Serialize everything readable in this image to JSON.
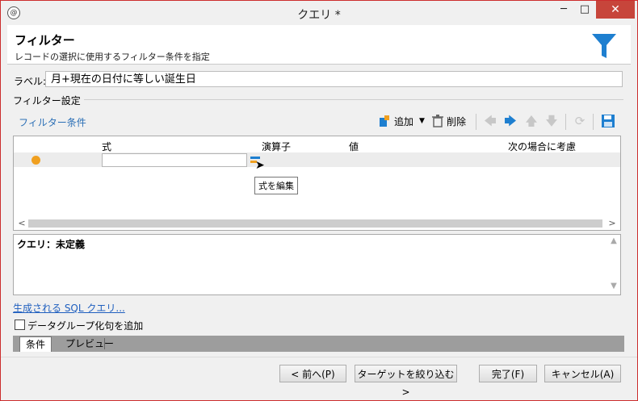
{
  "window": {
    "app_icon_glyph": "@",
    "title": "クエリ *",
    "minimize_glyph": "─",
    "maximize_glyph": "□",
    "close_glyph": "✕"
  },
  "header": {
    "title": "フィルター",
    "subtitle": "レコードの選択に使用するフィルター条件を指定"
  },
  "label_field": {
    "label": "ラベル:",
    "value": "月+現在の日付に等しい誕生日"
  },
  "filter_settings": {
    "group_title": "フィルター設定",
    "conditions_link": "フィルター条件",
    "add_label": "追加",
    "delete_label": "削除"
  },
  "grid": {
    "columns": [
      "式",
      "演算子",
      "値",
      "次の場合に考慮"
    ],
    "tooltip": "式を編集"
  },
  "query_box": {
    "text": "クエリ：未定義"
  },
  "sql_link": "生成される SQL クエリ...",
  "group_by_checkbox": {
    "label": "データグループ化句を追加",
    "checked": false
  },
  "tabs": [
    {
      "label": "条件",
      "active": true
    },
    {
      "label": "プレビュー",
      "active": false
    }
  ],
  "buttons": {
    "prev": "< 前へ(P)",
    "target": "ターゲットを絞り込む>",
    "finish": "完了(F)",
    "cancel": "キャンセル(A)"
  },
  "colors": {
    "accent_blue": "#1e7fd0",
    "status_orange": "#f0a020",
    "close_red": "#c7453b"
  }
}
